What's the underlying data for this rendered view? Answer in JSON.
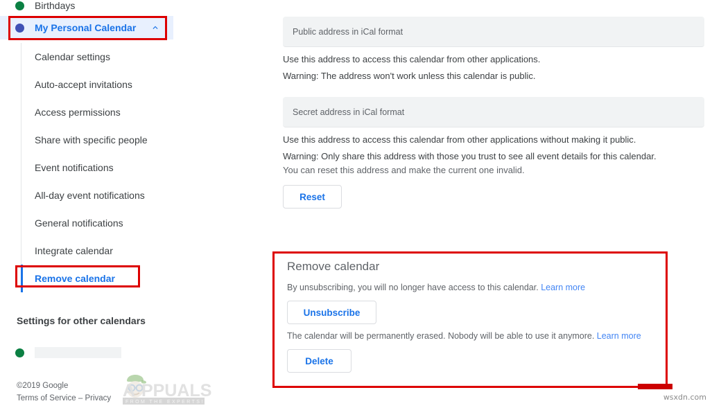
{
  "sidebar": {
    "calendars": [
      {
        "label": "Birthdays",
        "dot": "green-dot",
        "color": "#0b8043"
      },
      {
        "label": "My Personal Calendar",
        "dot": "blue-dot",
        "color": "#3f51b5",
        "selected": true,
        "chevron": "chevron-up-icon"
      }
    ],
    "subitems": [
      {
        "label": "Calendar settings",
        "active": false
      },
      {
        "label": "Auto-accept invitations",
        "active": false
      },
      {
        "label": "Access permissions",
        "active": false
      },
      {
        "label": "Share with specific people",
        "active": false
      },
      {
        "label": "Event notifications",
        "active": false
      },
      {
        "label": "All-day event notifications",
        "active": false
      },
      {
        "label": "General notifications",
        "active": false
      },
      {
        "label": "Integrate calendar",
        "active": false
      },
      {
        "label": "Remove calendar",
        "active": true
      }
    ],
    "other_calendars_heading": "Settings for other calendars",
    "other_calendar_dot": "green-dot",
    "footer": {
      "copyright": "©2019 Google",
      "terms": "Terms of Service",
      "separator": " – ",
      "privacy": "Privacy"
    }
  },
  "main": {
    "public_address": {
      "placeholder": "Public address in iCal format",
      "note_1": "Use this address to access this calendar from other applications.",
      "note_2": "Warning: The address won't work unless this calendar is public."
    },
    "secret_address": {
      "placeholder": "Secret address in iCal format",
      "note_1": "Use this address to access this calendar from other applications without making it public.",
      "note_2": "Warning: Only share this address with those you trust to see all event details for this calendar.",
      "note_3": "You can reset this address and make the current one invalid.",
      "reset_label": "Reset"
    },
    "remove_calendar": {
      "title": "Remove calendar",
      "unsubscribe_note": "By unsubscribing, you will no longer have access to this calendar.",
      "unsubscribe_learn_more": "Learn more",
      "unsubscribe_label": "Unsubscribe",
      "delete_note": "The calendar will be permanently erased. Nobody will be able to use it anymore.",
      "delete_learn_more": "Learn more",
      "delete_label": "Delete"
    }
  },
  "annotations": {
    "highlight_color": "#dd0000",
    "accent_blue": "#1a73e8",
    "link_blue": "#4285f4"
  },
  "watermarks": {
    "appuals_main": "APPUALS",
    "appuals_tagline": "FROM THE EXPERTS!",
    "bottom_right": "wsxdn.com"
  }
}
